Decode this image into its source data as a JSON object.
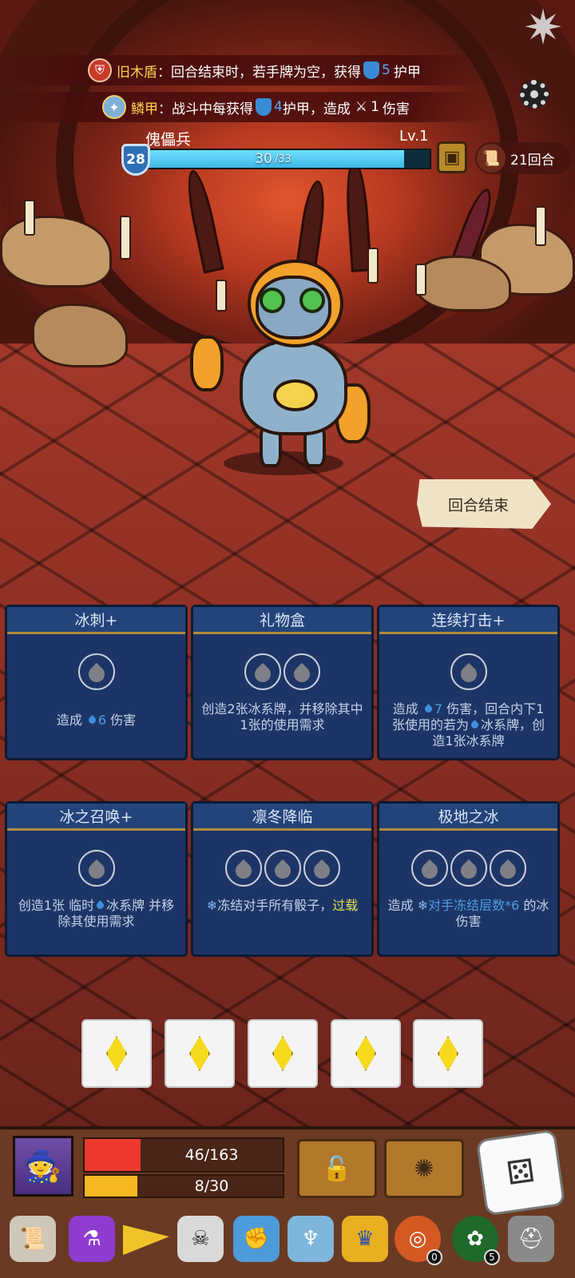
{
  "buffs": [
    {
      "icon": "old-wooden-shield-icon",
      "name": "旧木盾",
      "text_before": "：回合结束时，若手牌为空，获得",
      "value": "5",
      "text_after": "护甲"
    },
    {
      "icon": "scale-armor-icon",
      "name": "鳞甲",
      "text_before": "：战斗中每获得",
      "value": "4",
      "text_mid": "护甲，造成",
      "damage": "1",
      "text_after": "伤害"
    }
  ],
  "enemy": {
    "name": "傀儡兵",
    "level": "Lv.1",
    "armor": "28",
    "hp_current": "30",
    "hp_max": "/33",
    "hp_fraction": 0.909
  },
  "turn_counter": "21回合",
  "end_turn_label": "回合结束",
  "cards": [
    {
      "title": "冰刺+",
      "cost": 1,
      "desc_parts": [
        "造成 ",
        "6",
        " 伤害"
      ]
    },
    {
      "title": "礼物盒",
      "cost": 2,
      "desc": "创造2张冰系牌，并移除其中1张的使用需求"
    },
    {
      "title": "连续打击+",
      "cost": 1,
      "desc_a": "造成 ",
      "desc_val": "7",
      "desc_b": " 伤害，回合内下1张使用的若为",
      "desc_c": "冰系牌，创造1张冰系牌"
    },
    {
      "title": "冰之召唤+",
      "cost": 1,
      "desc_a": "创造1张 临时",
      "desc_b": "冰系牌 并移除其使用需求"
    },
    {
      "title": "凛冬降临",
      "cost": 3,
      "desc_a": "冻结对手所有骰子，",
      "desc_kw": "过载"
    },
    {
      "title": "极地之冰",
      "cost": 3,
      "desc_a": "造成 ",
      "desc_kw": "对手冻结层数*6",
      "desc_b": " 的冰伤害"
    }
  ],
  "dice_slots": 5,
  "player": {
    "hp_text": "46/163",
    "hp_fraction": 0.282,
    "energy_text": "8/30",
    "energy_fraction": 0.267,
    "hp_color": "#ee3a2e",
    "energy_color": "#f5b823"
  },
  "relics": [
    {
      "icon": "scroll-icon"
    },
    {
      "icon": "potion-flask-icon"
    },
    {
      "icon": "cheese-wedge-icon"
    },
    {
      "icon": "horned-skull-icon"
    },
    {
      "icon": "crystal-gauntlet-icon"
    },
    {
      "icon": "horn-cornucopia-icon"
    },
    {
      "icon": "gold-crown-icon"
    },
    {
      "icon": "fire-ring-icon",
      "count": "0"
    },
    {
      "icon": "green-wreath-icon",
      "count": "5"
    },
    {
      "icon": "iron-helmet-icon"
    }
  ]
}
